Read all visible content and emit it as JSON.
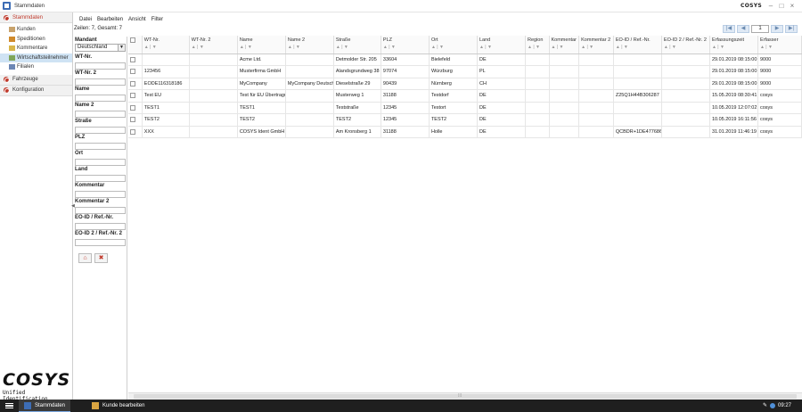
{
  "window": {
    "title": "Stammdaten",
    "brand": "COSYS"
  },
  "menu": [
    "Datei",
    "Bearbeiten",
    "Ansicht",
    "Filter"
  ],
  "sidebar": {
    "sections": [
      {
        "label": "Stammdaten",
        "active": true,
        "items": [
          {
            "label": "Kunden",
            "icon": "people-icon"
          },
          {
            "label": "Speditionen",
            "icon": "truck-icon"
          },
          {
            "label": "Kommentare",
            "icon": "comment-icon"
          },
          {
            "label": "Wirtschaftsteilnehmer",
            "icon": "folder-icon",
            "selected": true
          },
          {
            "label": "Filialen",
            "icon": "branch-icon"
          }
        ]
      },
      {
        "label": "Fahrzeuge",
        "active": false,
        "items": []
      },
      {
        "label": "Konfiguration",
        "active": false,
        "items": []
      }
    ],
    "logo_text": "COSYS",
    "logo_sub": "Unified Identification"
  },
  "status": {
    "count_text": "Zeilen: 7, Gesamt: 7",
    "page": "1"
  },
  "filters": {
    "mandant_label": "Mandant",
    "mandant_value": "Deutschland",
    "fields": [
      "WT-Nr.",
      "WT-Nr. 2",
      "Name",
      "Name 2",
      "Straße",
      "PLZ",
      "Ort",
      "Land",
      "Kommentar",
      "Kommentar 2",
      "EO-ID / Ref.-Nr.",
      "EO-ID 2 / Ref.-Nr. 2"
    ]
  },
  "table": {
    "columns": [
      "WT-Nr.",
      "WT-Nr. 2",
      "Name",
      "Name 2",
      "Straße",
      "PLZ",
      "Ort",
      "Land",
      "Region",
      "Kommentar",
      "Kommentar 2",
      "EO-ID / Ref.-Nr.",
      "EO-ID 2 / Ref.-Nr. 2",
      "Erfassungszeit",
      "Erfasser"
    ],
    "rows": [
      [
        "",
        "",
        "Acme Ltd.",
        "",
        "Detmolder Str. 205",
        "33604",
        "Bielefeld",
        "DE",
        "",
        "",
        "",
        "",
        "",
        "29.01.2019 08:15:00",
        "9000"
      ],
      [
        "123456",
        "",
        "Musterfirma GmbH",
        "",
        "Alandsgrundweg 38",
        "97074",
        "Würzburg",
        "PL",
        "",
        "",
        "",
        "",
        "",
        "29.01.2019 08:15:00",
        "9000"
      ],
      [
        "EODE116318186",
        "",
        "MyCompany",
        "MyCompany Deutschland",
        "Dieselstraße 29",
        "90439",
        "Nürnberg",
        "CH",
        "",
        "",
        "",
        "",
        "",
        "29.01.2019 08:15:00",
        "9000"
      ],
      [
        "Test EU",
        "",
        "Test für EU Übertragung",
        "",
        "Musterweg 1",
        "31188",
        "Testdorf",
        "DE",
        "",
        "",
        "",
        "Z25Q1H44B306287",
        "",
        "15.05.2019 08:30:41",
        "cosys"
      ],
      [
        "TEST1",
        "",
        "TEST1",
        "",
        "Teststraße",
        "12345",
        "Testort",
        "DE",
        "",
        "",
        "",
        "",
        "",
        "10.05.2019 12:07:02",
        "cosys"
      ],
      [
        "TEST2",
        "",
        "TEST2",
        "",
        "TEST2",
        "12345",
        "TEST2",
        "DE",
        "",
        "",
        "",
        "",
        "",
        "10.05.2019 16:11:56",
        "cosys"
      ],
      [
        "XXX",
        "",
        "COSYS Ident GmbH",
        "",
        "Am Kronsberg 1",
        "31188",
        "Holle",
        "DE",
        "",
        "",
        "",
        "QCBDR+1DE477686",
        "",
        "31.01.2019 11:46:19",
        "cosys"
      ]
    ]
  },
  "taskbar": {
    "tasks": [
      "Stammdaten",
      "Kunde bearbeiten"
    ],
    "time": "09:27"
  },
  "colors": {
    "accent": "#c0392b",
    "selection": "#cfe3f4",
    "taskbar": "#1f1f1f"
  }
}
